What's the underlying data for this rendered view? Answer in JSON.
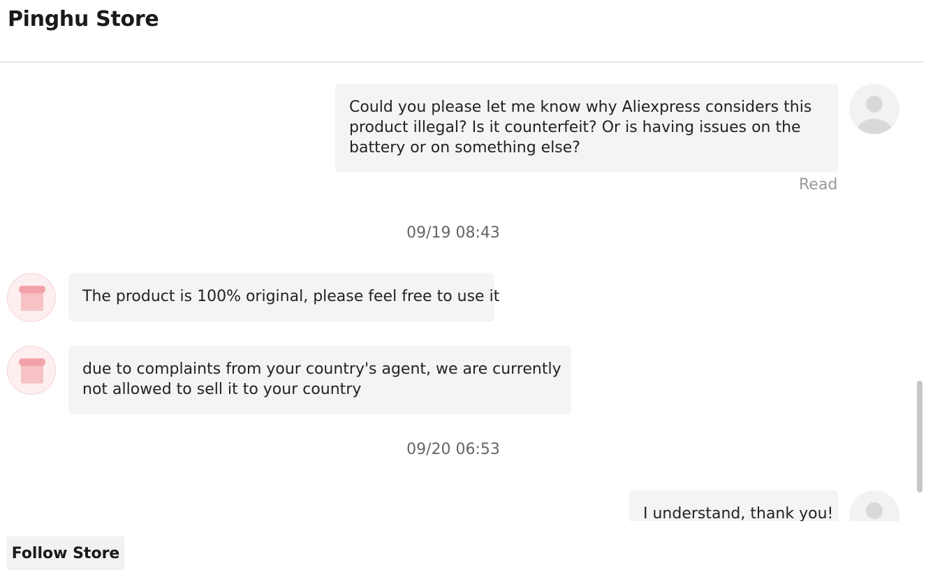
{
  "header": {
    "store_name": "Pinghu Store"
  },
  "messages": [
    {
      "sender": "user",
      "lines": [
        "Could you please let me know why Aliexpress considers this",
        "product illegal? Is it counterfeit? Or is having issues on the",
        "battery or on something else?"
      ],
      "status": "Read"
    },
    {
      "timestamp": "09/19 08:43"
    },
    {
      "sender": "store",
      "lines": [
        "The product is 100% original, please feel free to use it"
      ]
    },
    {
      "sender": "store",
      "lines": [
        "due to complaints from your country's agent, we are currently",
        "not allowed to sell it to your country"
      ]
    },
    {
      "timestamp": "09/20 06:53"
    },
    {
      "sender": "user",
      "lines": [
        "I understand, thank you!"
      ]
    }
  ],
  "footer": {
    "follow_label": "Follow Store"
  },
  "icons": {
    "user_avatar": "user-silhouette-icon",
    "store_avatar": "storefront-icon"
  },
  "colors": {
    "bubble_bg": "#f4f4f4",
    "store_avatar_bg": "#fdeef0",
    "store_awning": "#f2a3aa"
  }
}
